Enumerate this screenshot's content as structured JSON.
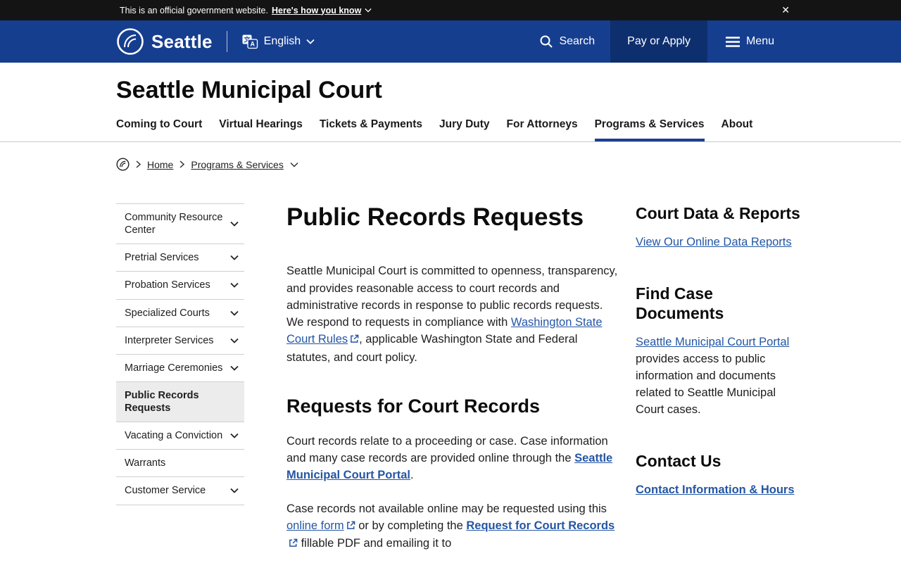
{
  "banner": {
    "text": "This is an official government website.",
    "link": "Here's how you know",
    "close_label": "✕"
  },
  "header": {
    "city": "Seattle",
    "language": "English",
    "search_label": "Search",
    "pay_label": "Pay or Apply",
    "menu_label": "Menu"
  },
  "site": {
    "title": "Seattle Municipal Court"
  },
  "nav": {
    "items": [
      "Coming to Court",
      "Virtual Hearings",
      "Tickets & Payments",
      "Jury Duty",
      "For Attorneys",
      "Programs & Services",
      "About"
    ],
    "active_index": 5
  },
  "breadcrumb": {
    "home": "Home",
    "current": "Programs & Services"
  },
  "sidebar": {
    "items": [
      {
        "label": "Community Resource Center",
        "chevron": true,
        "active": false
      },
      {
        "label": "Pretrial Services",
        "chevron": true,
        "active": false
      },
      {
        "label": "Probation Services",
        "chevron": true,
        "active": false
      },
      {
        "label": "Specialized Courts",
        "chevron": true,
        "active": false
      },
      {
        "label": "Interpreter Services",
        "chevron": true,
        "active": false
      },
      {
        "label": "Marriage Ceremonies",
        "chevron": true,
        "active": false
      },
      {
        "label": "Public Records Requests",
        "chevron": false,
        "active": true
      },
      {
        "label": "Vacating a Conviction",
        "chevron": true,
        "active": false
      },
      {
        "label": "Warrants",
        "chevron": false,
        "active": false
      },
      {
        "label": "Customer Service",
        "chevron": true,
        "active": false
      }
    ]
  },
  "main": {
    "title": "Public Records Requests",
    "intro": {
      "part1": "Seattle Municipal Court is committed to openness, transparency, and provides reasonable access to court records and administrative records in response to public records requests. We respond to requests in compliance with ",
      "link1": "Washington State Court Rules",
      "part2": ", applicable Washington State and Federal statutes, and court policy."
    },
    "section1": {
      "heading": "Requests for Court Records",
      "p1_part1": "Court records relate to a proceeding or case. Case information and many case records are provided online through the ",
      "p1_link": "Seattle Municipal Court Portal",
      "p1_part2": ".",
      "p2_part1": "Case records not available online may be requested using this ",
      "p2_link1": "online form",
      "p2_part2": " or by completing the ",
      "p2_link2": "Request for Court Records",
      "p2_part3": " fillable PDF and emailing it to"
    }
  },
  "aside": {
    "data_reports": {
      "heading": "Court Data & Reports",
      "link": "View Our Online Data Reports"
    },
    "case_docs": {
      "heading": "Find Case Documents",
      "link": "Seattle Municipal Court Portal",
      "text": " provides access to public information and documents related to Seattle Municipal Court cases."
    },
    "contact": {
      "heading": "Contact Us",
      "link": "Contact Information & Hours"
    }
  },
  "colors": {
    "header_blue": "#163e8f",
    "pay_button_blue": "#0e2f6e",
    "nav_active_blue": "#1b3e94",
    "link_blue": "#2456a4",
    "banner_black": "#141414",
    "sidebar_active_bg": "#ececec"
  }
}
